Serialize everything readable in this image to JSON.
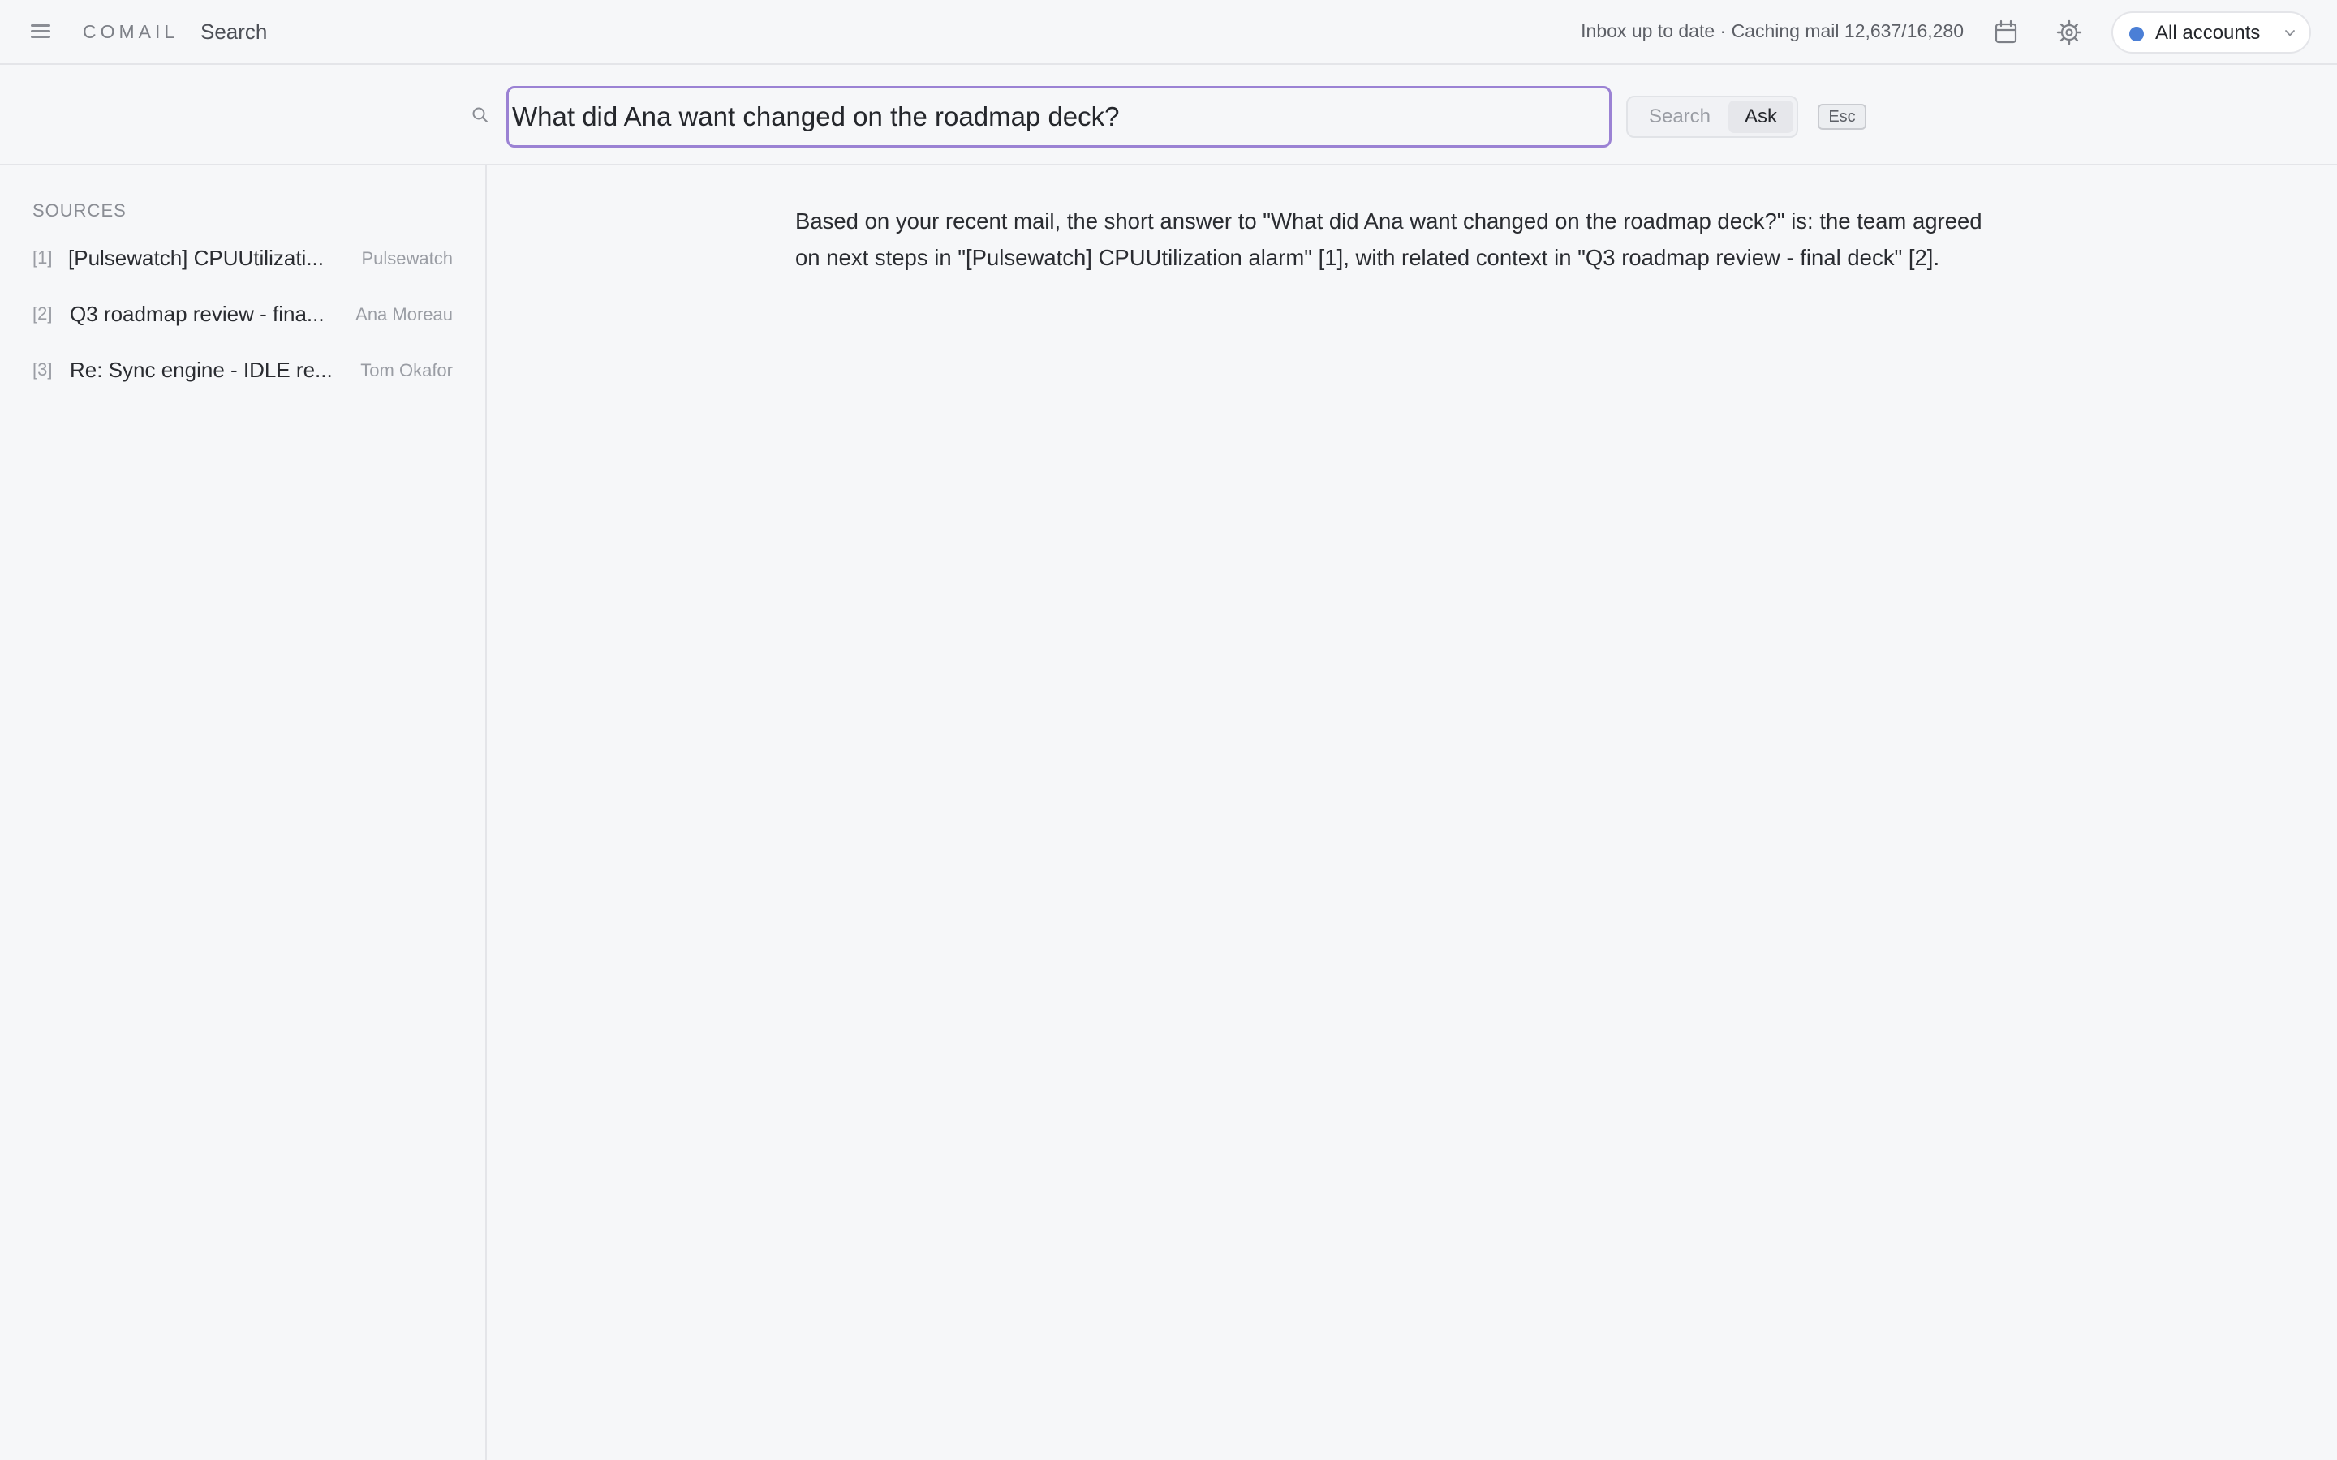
{
  "app": {
    "brand": "COMAIL",
    "page_title": "Search",
    "sync_status": "Inbox up to date · Caching mail 12,637/16,280",
    "account_label": "All accounts",
    "icons": {
      "menu": "menu-icon",
      "calendar": "calendar-icon",
      "settings": "gear-icon",
      "chevron": "chevron-down-icon",
      "search": "search-icon"
    },
    "colors": {
      "accent": "#9b82d4",
      "account_dot": "#4b7fd6"
    }
  },
  "search": {
    "query": "What did Ana want changed on the roadmap deck?",
    "mode_search_label": "Search",
    "mode_ask_label": "Ask",
    "active_mode": "Ask",
    "esc_label": "Esc"
  },
  "sources": {
    "heading": "SOURCES",
    "items": [
      {
        "num": "[1]",
        "title": "[Pulsewatch] CPUUtilizati...",
        "sender": "Pulsewatch"
      },
      {
        "num": "[2]",
        "title": "Q3 roadmap review - fina...",
        "sender": "Ana Moreau"
      },
      {
        "num": "[3]",
        "title": "Re: Sync engine - IDLE re...",
        "sender": "Tom Okafor"
      }
    ]
  },
  "answer": {
    "text": "Based on your recent mail, the short answer to \"What did Ana want changed on the roadmap deck?\" is: the team agreed on next steps in \"[Pulsewatch] CPUUtilization alarm\" [1], with related context in \"Q3 roadmap review - final deck\" [2]."
  }
}
